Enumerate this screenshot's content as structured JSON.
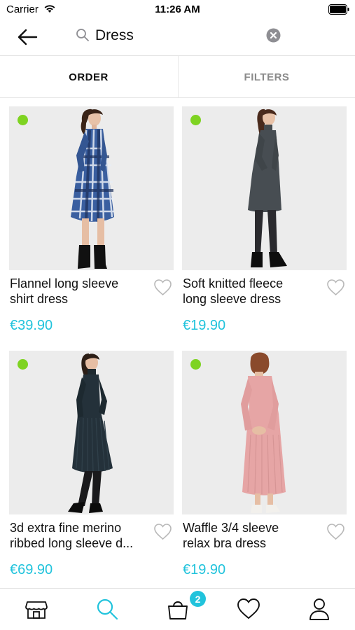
{
  "status_bar": {
    "carrier": "Carrier",
    "time": "11:26 AM",
    "icons": [
      "wifi-icon",
      "battery-icon"
    ]
  },
  "search": {
    "query": "Dress",
    "icons": [
      "back-arrow-icon",
      "search-icon",
      "clear-icon"
    ]
  },
  "toolbar": {
    "order_label": "ORDER",
    "filters_label": "FILTERS"
  },
  "products": [
    {
      "name_line1": "Flannel long sleeve",
      "name_line2": "shirt dress",
      "price": "€39.90",
      "in_stock": true
    },
    {
      "name_line1": "Soft knitted fleece",
      "name_line2": "long sleeve dress",
      "price": "€19.90",
      "in_stock": true
    },
    {
      "name_line1": "3d extra fine merino",
      "name_line2": "ribbed long sleeve d...",
      "price": "€69.90",
      "in_stock": true
    },
    {
      "name_line1": "Waffle 3/4 sleeve",
      "name_line2": "relax bra dress",
      "price": "€19.90",
      "in_stock": true
    }
  ],
  "bottom_nav": {
    "items": [
      "store-icon",
      "search-icon",
      "shopping-bag-icon",
      "heart-icon",
      "user-icon"
    ],
    "cart_count": "2"
  },
  "colors": {
    "accent": "#21c3dc",
    "stock_dot": "#7ed321",
    "image_bg": "#ececec",
    "muted_text": "#8a8a8a"
  }
}
